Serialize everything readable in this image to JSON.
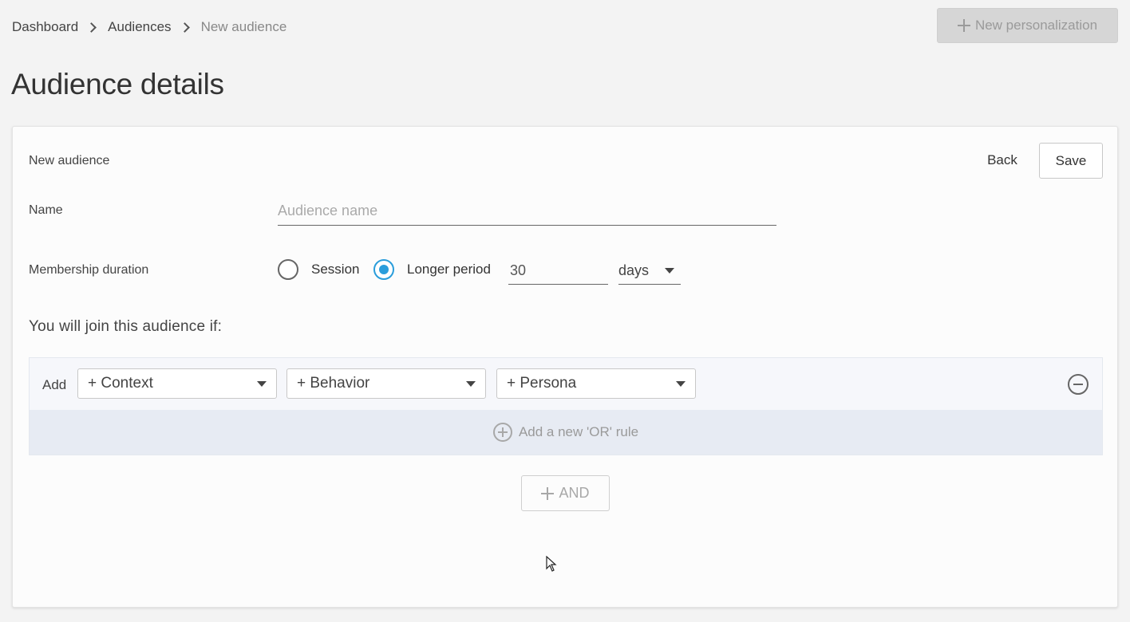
{
  "breadcrumb": [
    "Dashboard",
    "Audiences",
    "New audience"
  ],
  "header": {
    "new_personalization_label": "New personalization"
  },
  "page_title": "Audience details",
  "card": {
    "title": "New audience",
    "back_label": "Back",
    "save_label": "Save"
  },
  "form": {
    "name_label": "Name",
    "name_placeholder": "Audience name",
    "name_value": "",
    "duration_label": "Membership duration",
    "duration_options": [
      {
        "label": "Session",
        "selected": false
      },
      {
        "label": "Longer period",
        "selected": true
      }
    ],
    "duration_value": "30",
    "duration_unit": "days"
  },
  "rules": {
    "intro": "You will join this audience if:",
    "add_label": "Add",
    "dropdowns": [
      "+ Context",
      "+ Behavior",
      "+ Persona"
    ],
    "or_rule_label": "Add a new 'OR' rule",
    "and_label": "AND"
  },
  "colors": {
    "accent": "#2a9ddb",
    "background": "#f3f3f3",
    "rule_row": "#f6f7fb",
    "or_row": "#e7ebf3",
    "disabled_button": "#d6d6d6"
  }
}
